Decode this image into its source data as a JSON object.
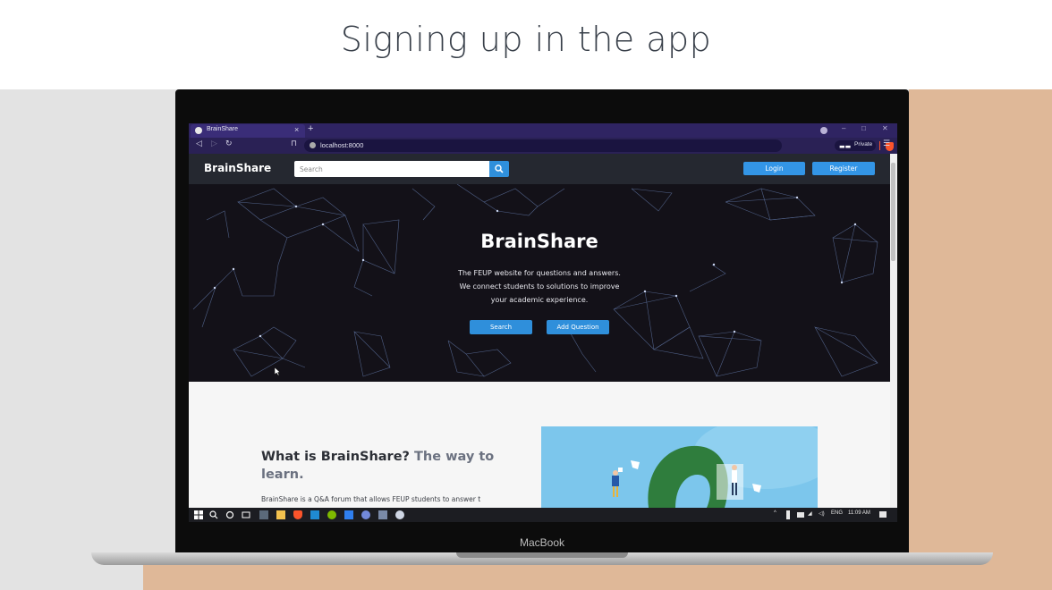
{
  "slide": {
    "title": "Signing up in the app"
  },
  "device": {
    "label": "MacBook"
  },
  "browser": {
    "tab_title": "BrainShare",
    "tab_close": "×",
    "new_tab": "+",
    "url": "localhost:8000",
    "private_label": "Private"
  },
  "site": {
    "brand": "BrainShare",
    "search_placeholder": "Search",
    "login_label": "Login",
    "register_label": "Register"
  },
  "hero": {
    "title": "BrainShare",
    "subtitle_lines": [
      "The FEUP website for questions and answers.",
      "We connect students to solutions to improve",
      "your academic experience."
    ],
    "search_button": "Search",
    "add_question_button": "Add Question"
  },
  "about": {
    "heading_main": "What is BrainShare?",
    "heading_accent": "The way to learn.",
    "paragraph": "BrainShare is a Q&A forum that allows FEUP students to answer t"
  },
  "taskbar": {
    "language": "ENG",
    "time": "11:09 AM"
  },
  "colors": {
    "accent_blue": "#2f8fdb",
    "nav_bg": "#252830",
    "hero_bg": "#131118",
    "browser_purple": "#2f2462"
  }
}
